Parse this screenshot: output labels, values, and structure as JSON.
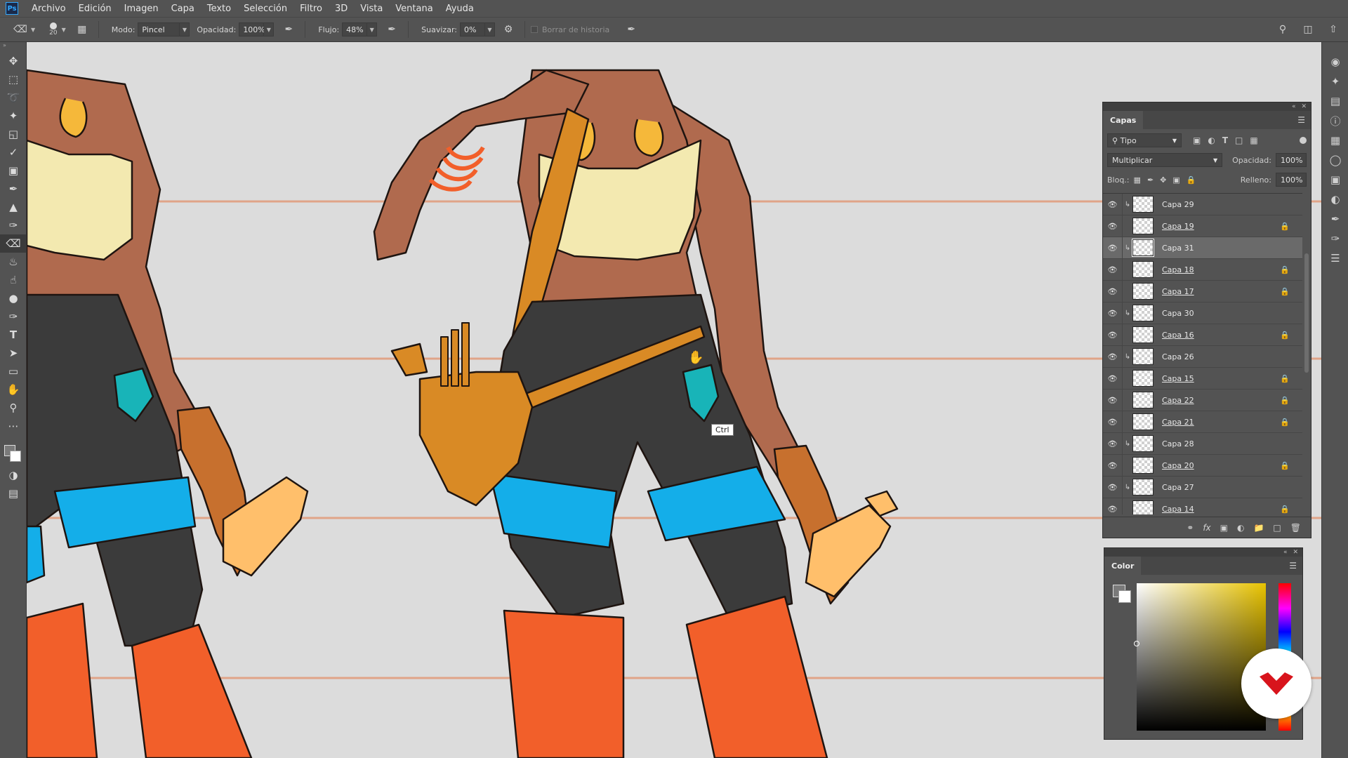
{
  "menubar": {
    "app_icon": "Ps",
    "items": [
      "Archivo",
      "Edición",
      "Imagen",
      "Capa",
      "Texto",
      "Selección",
      "Filtro",
      "3D",
      "Vista",
      "Ventana",
      "Ayuda"
    ]
  },
  "options": {
    "brush_size": "20",
    "modo_label": "Modo:",
    "modo_value": "Pincel",
    "opacidad_label": "Opacidad:",
    "opacidad_value": "100%",
    "flujo_label": "Flujo:",
    "flujo_value": "48%",
    "suavizar_label": "Suavizar:",
    "suavizar_value": "0%",
    "borrar_historia_label": "Borrar de historia"
  },
  "canvas": {
    "tooltip": "Ctrl"
  },
  "layers_panel": {
    "tab": "Capas",
    "filter_kind": "Tipo",
    "blend_mode": "Multiplicar",
    "opacity_label": "Opacidad:",
    "opacity_value": "100%",
    "lock_label": "Bloq.:",
    "fill_label": "Relleno:",
    "fill_value": "100%",
    "layers": [
      {
        "name": "Capa 29",
        "clipped": true,
        "locked": false,
        "selected": false
      },
      {
        "name": "Capa 19",
        "clipped": false,
        "locked": true,
        "selected": false
      },
      {
        "name": "Capa 31",
        "clipped": true,
        "locked": false,
        "selected": true
      },
      {
        "name": "Capa 18",
        "clipped": false,
        "locked": true,
        "selected": false
      },
      {
        "name": "Capa 17",
        "clipped": false,
        "locked": true,
        "selected": false
      },
      {
        "name": "Capa 30",
        "clipped": true,
        "locked": false,
        "selected": false
      },
      {
        "name": "Capa 16",
        "clipped": false,
        "locked": true,
        "selected": false
      },
      {
        "name": "Capa 26",
        "clipped": true,
        "locked": false,
        "selected": false
      },
      {
        "name": "Capa 15",
        "clipped": false,
        "locked": true,
        "selected": false
      },
      {
        "name": "Capa 22",
        "clipped": false,
        "locked": true,
        "selected": false
      },
      {
        "name": "Capa 21",
        "clipped": false,
        "locked": true,
        "selected": false
      },
      {
        "name": "Capa 28",
        "clipped": true,
        "locked": false,
        "selected": false
      },
      {
        "name": "Capa 20",
        "clipped": false,
        "locked": true,
        "selected": false
      },
      {
        "name": "Capa 27",
        "clipped": true,
        "locked": false,
        "selected": false
      },
      {
        "name": "Capa 14",
        "clipped": false,
        "locked": true,
        "selected": false
      }
    ]
  },
  "color_panel": {
    "tab": "Color",
    "foreground": "#7a7a7a",
    "background": "#ffffff"
  },
  "colors": {
    "ui_bg": "#535353",
    "canvas_bg": "#dcdcdc",
    "guide_line": "#e0a488",
    "skin": "#b06a4e",
    "top": "#f3e9b0",
    "pants_dark": "#3b3b3b",
    "pants_blue": "#14aee9",
    "pants_orange": "#f25f2a",
    "bag": "#d98a25",
    "gloves": "#c7702e",
    "teal_tag": "#18b4b8",
    "logo_red": "#d8141c"
  },
  "icons": {
    "toolbar": [
      "move-icon",
      "marquee-icon",
      "lasso-icon",
      "magic-wand-icon",
      "crop-icon",
      "eyedropper-icon",
      "frame-icon",
      "brush-icon",
      "stamp-icon",
      "history-brush-icon",
      "eraser-icon",
      "paint-bucket-icon",
      "smudge-icon",
      "dodge-icon",
      "pen-icon",
      "type-icon",
      "path-select-icon",
      "rectangle-icon",
      "hand-icon",
      "zoom-icon",
      "more-icon"
    ]
  }
}
